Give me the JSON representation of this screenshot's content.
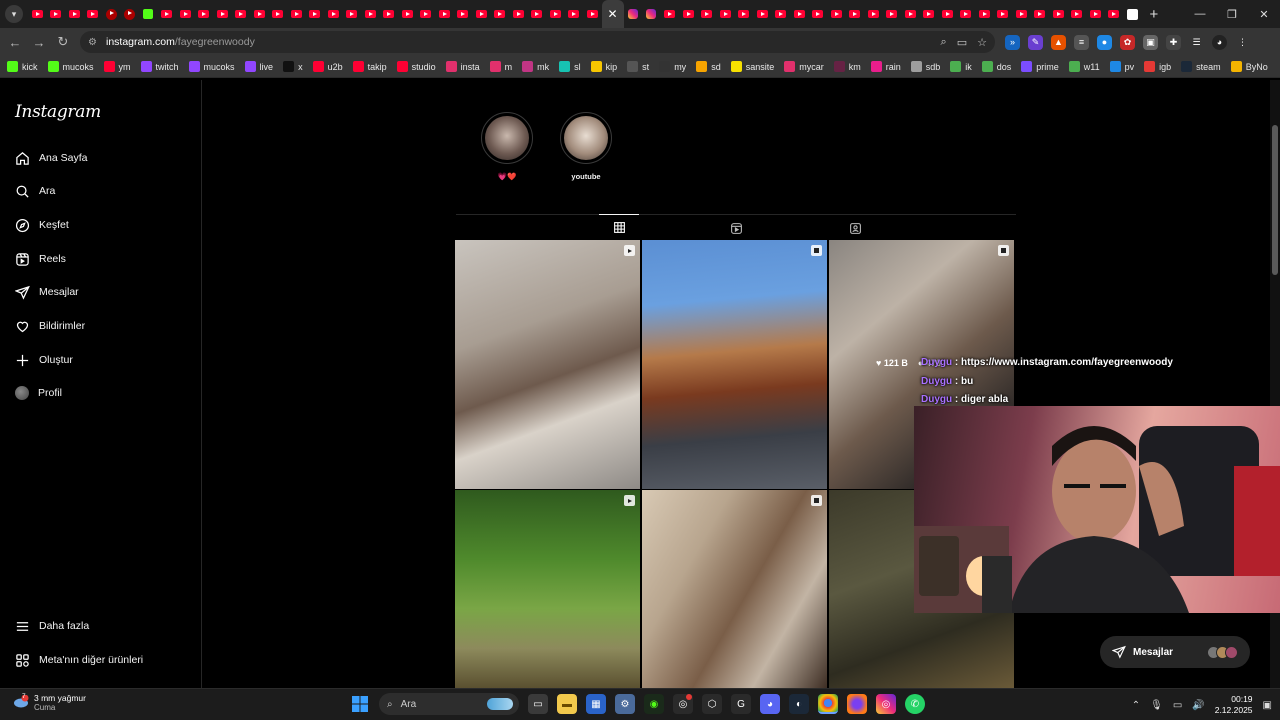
{
  "browser": {
    "tab_count_youtube": 31,
    "active_tab_close": "✕",
    "new_tab": "+",
    "url_host": "instagram.com",
    "url_path": "/fayegreenwoody"
  },
  "bookmarks": [
    {
      "label": "kick",
      "color": "#53fc18"
    },
    {
      "label": "mucoks",
      "color": "#53fc18"
    },
    {
      "label": "ym",
      "color": "#ff0033"
    },
    {
      "label": "twitch",
      "color": "#9146ff"
    },
    {
      "label": "mucoks",
      "color": "#9146ff"
    },
    {
      "label": "live",
      "color": "#9146ff"
    },
    {
      "label": "x",
      "color": "#111111"
    },
    {
      "label": "u2b",
      "color": "#ff0033"
    },
    {
      "label": "takip",
      "color": "#ff0033"
    },
    {
      "label": "studio",
      "color": "#ff0033"
    },
    {
      "label": "insta",
      "color": "#e1306c"
    },
    {
      "label": "m",
      "color": "#e1306c"
    },
    {
      "label": "mk",
      "color": "#c13584"
    },
    {
      "label": "sl",
      "color": "#17c3b2"
    },
    {
      "label": "kip",
      "color": "#f7c600"
    },
    {
      "label": "st",
      "color": "#555555"
    },
    {
      "label": "my",
      "color": "#333333"
    },
    {
      "label": "sd",
      "color": "#f7a400"
    },
    {
      "label": "sansite",
      "color": "#f7e000"
    },
    {
      "label": "mycar",
      "color": "#e1306c"
    },
    {
      "label": "km",
      "color": "#662244"
    },
    {
      "label": "rain",
      "color": "#e91e8c"
    },
    {
      "label": "sdb",
      "color": "#9e9e9e"
    },
    {
      "label": "ik",
      "color": "#4caf50"
    },
    {
      "label": "dos",
      "color": "#4caf50"
    },
    {
      "label": "prime",
      "color": "#7b4dff"
    },
    {
      "label": "w11",
      "color": "#4caf50"
    },
    {
      "label": "pv",
      "color": "#1e88e5"
    },
    {
      "label": "igb",
      "color": "#e53935"
    },
    {
      "label": "steam",
      "color": "#1b2838"
    },
    {
      "label": "ByNo",
      "color": "#f4b400"
    }
  ],
  "sidebar": {
    "logo": "Instagram",
    "items": [
      {
        "label": "Ana Sayfa",
        "icon": "home-icon"
      },
      {
        "label": "Ara",
        "icon": "search-icon"
      },
      {
        "label": "Keşfet",
        "icon": "compass-icon"
      },
      {
        "label": "Reels",
        "icon": "reels-icon"
      },
      {
        "label": "Mesajlar",
        "icon": "send-icon"
      },
      {
        "label": "Bildirimler",
        "icon": "heart-icon"
      },
      {
        "label": "Oluştur",
        "icon": "plus-icon"
      },
      {
        "label": "Profil",
        "icon": "avatar"
      }
    ],
    "more": "Daha fazla",
    "meta": "Meta'nın diğer ürünleri"
  },
  "highlights": [
    {
      "label": "💗❤️"
    },
    {
      "label": "youtube"
    }
  ],
  "overlay": {
    "likes": "121 B",
    "comments": "478",
    "chat": [
      {
        "user": "Duygu",
        "sep": " : ",
        "text": "https://www.instagram.com/fayegreenwoody"
      },
      {
        "user": "Duygu",
        "sep": " : ",
        "text": "bu"
      },
      {
        "user": "Duygu",
        "sep": " : ",
        "text": "diger abla"
      }
    ]
  },
  "messages_pill": {
    "label": "Mesajlar"
  },
  "taskbar": {
    "weather_temp": "3 mm yağmur",
    "weather_day": "Cuma",
    "weather_badge": "7",
    "search": "Ara",
    "time": "00:19",
    "date": "2.12.2025"
  }
}
